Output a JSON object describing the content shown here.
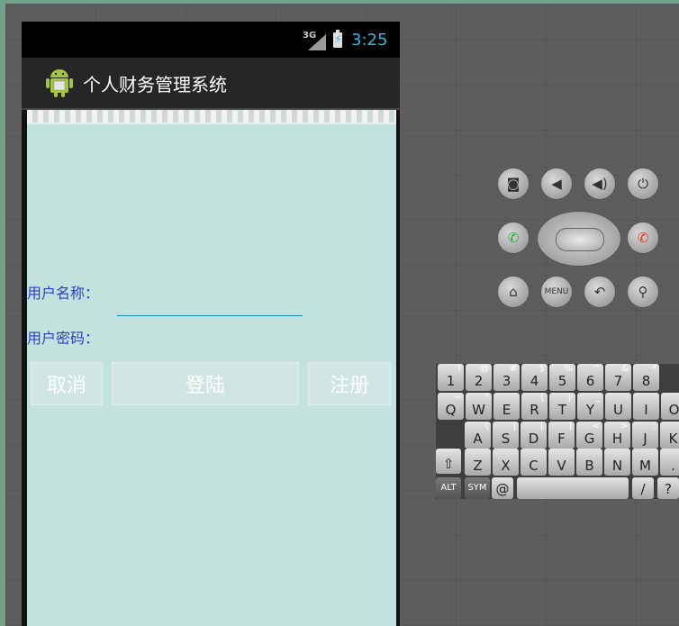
{
  "status_bar": {
    "network": "3G",
    "time": "3:25"
  },
  "app": {
    "title": "个人财务管理系统"
  },
  "form": {
    "username_label": "用户名称：",
    "password_label": "用户密码：",
    "cancel_label": "取消",
    "login_label": "登陆",
    "register_label": "注册"
  },
  "hardware": {
    "camera": "camera-icon",
    "volume_down": "volume-down-icon",
    "volume_up": "volume-up-icon",
    "power": "power-icon",
    "call": "call-icon",
    "end_call": "end-call-icon",
    "home": "home-icon",
    "menu_label": "MENU",
    "back": "back-icon",
    "search": "search-icon"
  },
  "keyboard": {
    "row1": [
      [
        "1",
        "!"
      ],
      [
        "2",
        "@"
      ],
      [
        "3",
        "#"
      ],
      [
        "4",
        "$"
      ],
      [
        "5",
        "%"
      ],
      [
        "6",
        "^"
      ],
      [
        "7",
        "&"
      ],
      [
        "8",
        "*"
      ]
    ],
    "row2": [
      [
        "Q",
        "~"
      ],
      [
        "W",
        "\""
      ],
      [
        "E",
        "`"
      ],
      [
        "R",
        "{"
      ],
      [
        "T",
        "}"
      ],
      [
        "Y",
        "_"
      ],
      [
        "U",
        "-"
      ],
      [
        "I",
        ""
      ],
      [
        "O",
        ""
      ]
    ],
    "row3": [
      [
        "A",
        "\\"
      ],
      [
        "S",
        "|"
      ],
      [
        "D",
        "["
      ],
      [
        "F",
        "]"
      ],
      [
        "G",
        "<"
      ],
      [
        "H",
        ">"
      ],
      [
        "J",
        ";"
      ],
      [
        "K",
        ""
      ]
    ],
    "row4": [
      [
        "Z",
        ""
      ],
      [
        "X",
        ""
      ],
      [
        "C",
        ""
      ],
      [
        "V",
        ""
      ],
      [
        "B",
        ""
      ],
      [
        "N",
        ""
      ],
      [
        "M",
        ""
      ],
      [
        ".",
        ""
      ]
    ],
    "alt_label": "ALT",
    "sym_label": "SYM",
    "at_label": "@",
    "slash_label": "/",
    "question_label": "?"
  },
  "colors": {
    "accent": "#33b5e5",
    "label": "#2a3fc7",
    "content_bg": "#c3e2dd"
  }
}
